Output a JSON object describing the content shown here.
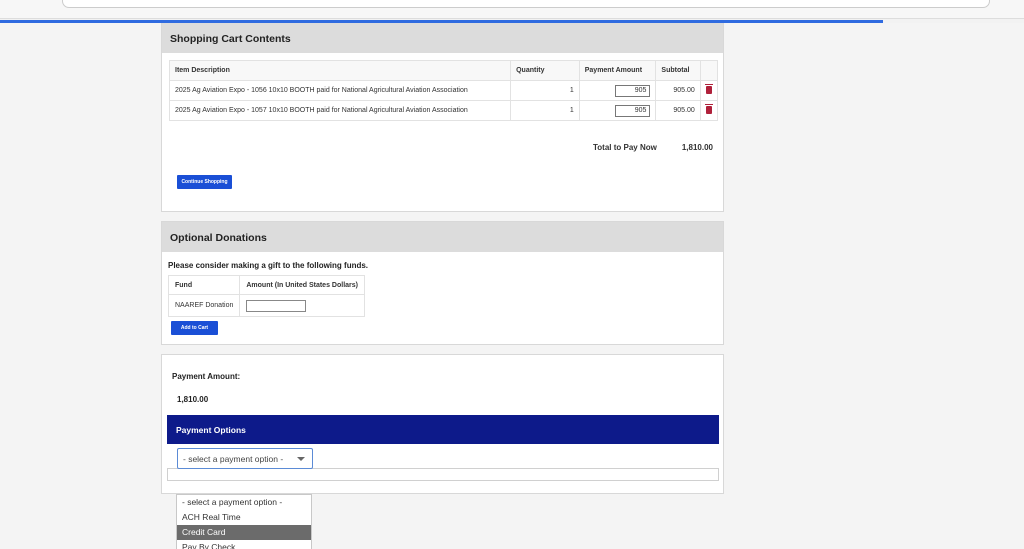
{
  "cart": {
    "heading": "Shopping Cart Contents",
    "columns": [
      "Item Description",
      "Quantity",
      "Payment Amount",
      "Subtotal"
    ],
    "rows": [
      {
        "description": "2025 Ag Aviation Expo - 1056 10x10 BOOTH paid for National Agricultural Aviation Association",
        "quantity": "1",
        "payment": "905",
        "subtotal": "905.00"
      },
      {
        "description": "2025 Ag Aviation Expo - 1057 10x10 BOOTH paid for National Agricultural Aviation Association",
        "quantity": "1",
        "payment": "905",
        "subtotal": "905.00"
      }
    ],
    "total_label": "Total to Pay Now",
    "total_value": "1,810.00",
    "continue_label": "Continue Shopping"
  },
  "donations": {
    "heading": "Optional Donations",
    "intro": "Please consider making a gift to the following funds.",
    "col_fund": "Fund",
    "col_amount": "Amount (In United States Dollars)",
    "fund_name": "NAAREF Donation",
    "amount_value": "",
    "add_label": "Add to Cart"
  },
  "payment": {
    "amount_label": "Payment Amount:",
    "amount_value": "1,810.00",
    "options_heading": "Payment Options",
    "selected": "- select a payment option -",
    "options": [
      "- select a payment option -",
      "ACH Real Time",
      "Credit Card",
      "Pay By Check"
    ],
    "highlighted_index": 2
  },
  "colors": {
    "accent_blue": "#1a4fd6",
    "options_bar": "#0d1a8a",
    "trash": "#b0213b"
  }
}
